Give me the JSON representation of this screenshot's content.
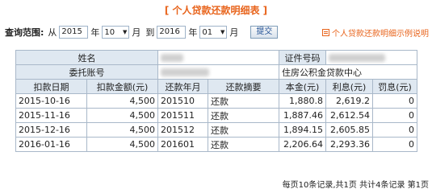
{
  "page": {
    "title": "[ 个人贷款还款明细表 ]"
  },
  "query": {
    "label": "查询范围:",
    "from_label": "从",
    "start_year": "2015",
    "year_label": "年",
    "start_month": "10",
    "month_label": "月",
    "to_label": "到",
    "end_year": "2016",
    "end_month": "01",
    "button_label": "提交"
  },
  "help_link": "个人贷款还款明细示例说明",
  "info": {
    "name_label": "姓名",
    "id_label": "证件号码",
    "entrust_label": "委托账号",
    "entrust_value": "住房公积金贷款中心"
  },
  "table": {
    "headers": [
      "扣款日期",
      "扣款金额(元)",
      "还款年月",
      "还款摘要",
      "本金(元)",
      "利息(元)",
      "罚息(元)"
    ],
    "rows": [
      [
        "2015-10-16",
        "4,500",
        "201510",
        "还款",
        "1,880.8",
        "2,619.2",
        "0"
      ],
      [
        "2015-11-16",
        "4,500",
        "201511",
        "还款",
        "1,887.46",
        "2,612.54",
        "0"
      ],
      [
        "2015-12-16",
        "4,500",
        "201512",
        "还款",
        "1,894.15",
        "2,605.85",
        "0"
      ],
      [
        "2016-01-16",
        "4,500",
        "201601",
        "还款",
        "2,206.64",
        "2,293.36",
        "0"
      ]
    ]
  },
  "footer": "每页10条记录,共1页 共计4条记录 第1页"
}
